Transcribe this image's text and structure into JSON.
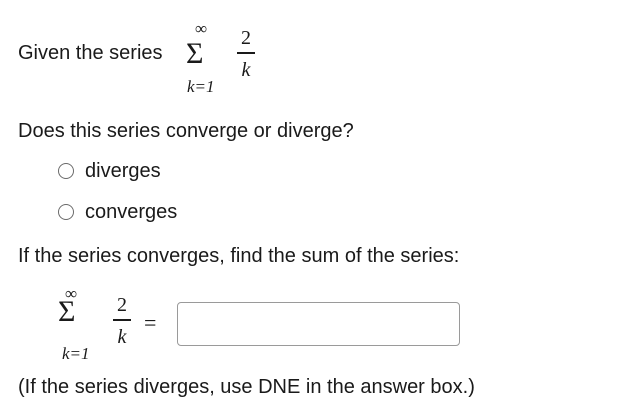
{
  "question": {
    "intro_text": "Given the series",
    "series": {
      "sum_symbol": "Σ",
      "upper_limit": "∞",
      "lower_limit": "k=1",
      "numerator": "2",
      "denominator": "k"
    },
    "prompt": "Does this series converge or diverge?",
    "options": [
      {
        "label": "diverges",
        "selected": false
      },
      {
        "label": "converges",
        "selected": false
      }
    ],
    "sum_prompt": "If the series converges, find the sum of the series:",
    "equation": {
      "sum_symbol": "Σ",
      "upper_limit": "∞",
      "lower_limit": "k=1",
      "numerator": "2",
      "denominator": "k",
      "equals": "="
    },
    "answer": {
      "value": "",
      "placeholder": ""
    },
    "note": "(If the series diverges, use DNE in the answer box.)"
  }
}
